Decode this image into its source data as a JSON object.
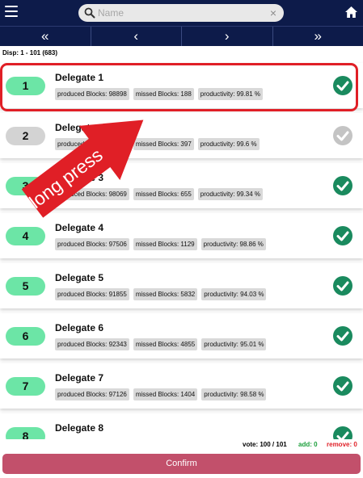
{
  "search": {
    "placeholder": "Name",
    "clear": "×"
  },
  "pagination": {
    "first": "«",
    "prev": "‹",
    "next": "›",
    "last": "»"
  },
  "display_label": "Disp: 1 - 101 (683)",
  "delegates": [
    {
      "rank": "1",
      "name": "Delegate 1",
      "produced": "produced Blocks: 98898",
      "missed": "missed Blocks: 188",
      "productivity": "productivity: 99.81 %",
      "voted": true
    },
    {
      "rank": "2",
      "name": "Delegate 2",
      "produced": "produced Blocks: 98560",
      "missed": "missed Blocks: 397",
      "productivity": "productivity: 99.6 %",
      "voted": false
    },
    {
      "rank": "3",
      "name": "Delegate 3",
      "produced": "produced Blocks: 98069",
      "missed": "missed Blocks: 655",
      "productivity": "productivity: 99.34 %",
      "voted": true
    },
    {
      "rank": "4",
      "name": "Delegate 4",
      "produced": "produced Blocks: 97506",
      "missed": "missed Blocks: 1129",
      "productivity": "productivity: 98.86 %",
      "voted": true
    },
    {
      "rank": "5",
      "name": "Delegate 5",
      "produced": "produced Blocks: 91855",
      "missed": "missed Blocks: 5832",
      "productivity": "productivity: 94.03 %",
      "voted": true
    },
    {
      "rank": "6",
      "name": "Delegate 6",
      "produced": "produced Blocks: 92343",
      "missed": "missed Blocks: 4855",
      "productivity": "productivity: 95.01 %",
      "voted": true
    },
    {
      "rank": "7",
      "name": "Delegate 7",
      "produced": "produced Blocks: 97126",
      "missed": "missed Blocks: 1404",
      "productivity": "productivity: 98.58 %",
      "voted": true
    },
    {
      "rank": "8",
      "name": "Delegate 8",
      "produced": "",
      "missed": "",
      "productivity": "",
      "voted": true
    }
  ],
  "annotation": {
    "text": "long press",
    "color": "#e01f26"
  },
  "footer": {
    "vote_label": "vote:",
    "vote_value": "100 / 101",
    "add_label": "add: 0",
    "remove_label": "remove: 0",
    "confirm_label": "Confirm"
  },
  "colors": {
    "header_bg": "#0d1b4a",
    "rank_active": "#6ce5a6",
    "rank_inactive": "#d3d3d3",
    "check_active": "#1a8a5e",
    "check_inactive": "#c4c4c4",
    "confirm_bg": "#c2506b",
    "add_color": "#1a9e3a",
    "remove_color": "#e01f26"
  }
}
